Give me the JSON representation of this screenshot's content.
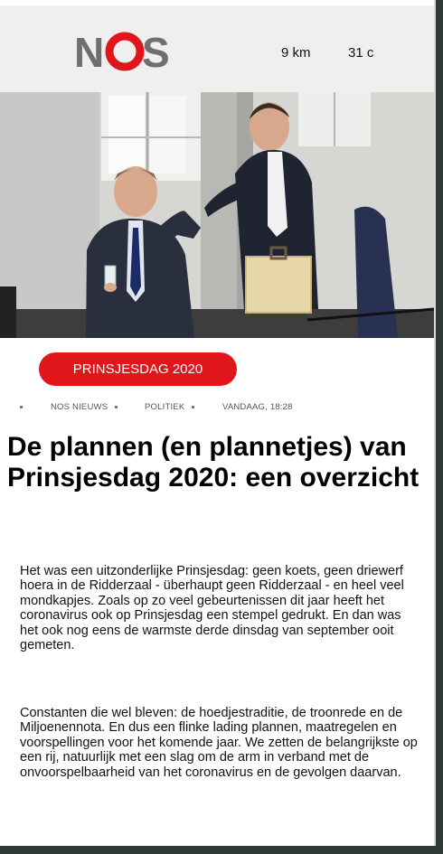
{
  "header": {
    "logo_text": "NOS",
    "distance": "9 km",
    "temperature": "31 c"
  },
  "article": {
    "tag": "PRINSJESDAG 2020",
    "meta": {
      "source": "NOS NIEUWS",
      "category": "POLITIEK",
      "timestamp": "VANDAAG, 18:28"
    },
    "headline": "De plannen (en plannetjes) van Prinsjesdag 2020: een overzicht",
    "paragraphs": [
      "Het was een uitzonderlijke Prinsjesdag: geen koets, geen driewerf hoera in de Ridderzaal - überhaupt geen Ridderzaal - en heel veel mondkapjes. Zoals op zo veel gebeurtenissen dit jaar heeft het coronavirus ook op Prinsjesdag een stempel gedrukt. En dan was het ook nog eens de warmste derde dinsdag van september ooit gemeten.",
      "Constanten die wel bleven: de hoedjestraditie, de troonrede en de Miljoenennota. En dus een flinke lading plannen, maatregelen en voorspellingen voor het komende jaar. We zetten de belangrijkste op een rij, natuurlijk met een slag om de arm in verband met de onvoorspelbaarheid van het coronavirus en de gevolgen daarvan."
    ]
  },
  "colors": {
    "brand_red": "#e0161b",
    "logo_gray": "#6f6f6f",
    "header_bg": "#efefef"
  }
}
